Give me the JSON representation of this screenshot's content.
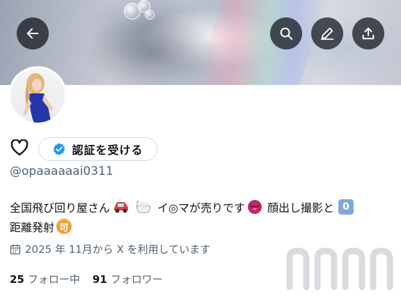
{
  "header": {
    "back_icon": "arrow-left-icon",
    "search_icon": "search-icon",
    "edit_icon": "pencil-icon",
    "share_icon": "share-upload-icon"
  },
  "profile": {
    "favorite_icon": "heart-outline-icon",
    "verify_label": "認証を受ける",
    "verify_icon": "verified-badge-icon",
    "handle": "@opaaaaaai0311",
    "bio_line1_a": "全国飛び回り屋さん",
    "bio_line1_b": "イ◎マが売りです",
    "bio_line1_c": "顔出し撮影と",
    "bio_badge_zero": "0",
    "bio_line2_a": "距離発射",
    "bio_badge_ka": "可",
    "joined": "2025 年 11月から X を利用しています",
    "following_count": "25",
    "following_label": "フォロー中",
    "followers_count": "91",
    "followers_label": "フォロワー"
  },
  "colors": {
    "accent": "#1d9bf0",
    "text_primary": "#0f1419",
    "text_secondary": "#536471",
    "border": "#cfd9de"
  }
}
